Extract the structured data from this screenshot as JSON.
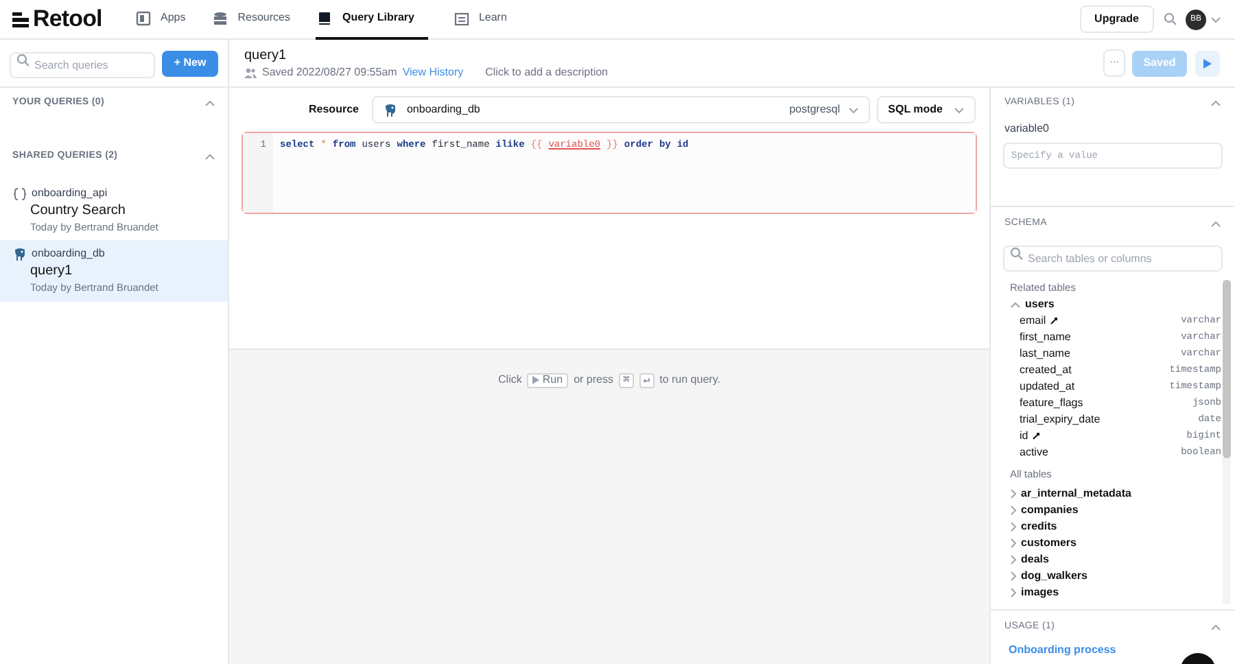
{
  "brand": {
    "name": "Retool"
  },
  "nav": [
    {
      "label": "Apps",
      "selected": false
    },
    {
      "label": "Resources",
      "selected": false
    },
    {
      "label": "Query Library",
      "selected": true
    },
    {
      "label": "Learn",
      "selected": false
    }
  ],
  "topbar": {
    "upgrade": "Upgrade",
    "avatar": "BB"
  },
  "sidebar": {
    "search_placeholder": "Search queries",
    "new_button": "+ New",
    "sections": [
      {
        "title": "YOUR QUERIES (0)",
        "expanded": true
      },
      {
        "title": "SHARED QUERIES (2)",
        "expanded": true,
        "items": [
          {
            "resource": "onboarding_api",
            "kind": "api",
            "name": "Country Search",
            "meta": "Today by Bertrand Bruandet",
            "selected": false
          },
          {
            "resource": "onboarding_db",
            "kind": "postgres",
            "name": "query1",
            "meta": "Today by Bertrand Bruandet",
            "selected": true
          }
        ]
      }
    ]
  },
  "query": {
    "name": "query1",
    "saved": "Saved 2022/08/27 09:55am",
    "history_link": "View History",
    "description_placeholder": "Click to add a description",
    "more_button": "···",
    "save_button": "Saved",
    "save_disabled": true
  },
  "resource": {
    "label": "Resource",
    "name": "onboarding_db",
    "type": "postgresql",
    "mode": "SQL mode"
  },
  "editor": {
    "error": true,
    "lines": [
      {
        "number": "1",
        "tokens": [
          {
            "text": "select",
            "kind": "keyword"
          },
          {
            "text": "*",
            "kind": "operator"
          },
          {
            "text": "from",
            "kind": "keyword"
          },
          {
            "text": "users",
            "kind": "ident"
          },
          {
            "text": "where",
            "kind": "keyword"
          },
          {
            "text": "first_name",
            "kind": "ident"
          },
          {
            "text": "ilike",
            "kind": "keyword"
          },
          {
            "text": "{{",
            "kind": "brace"
          },
          {
            "text": "variable0",
            "kind": "variable"
          },
          {
            "text": "}}",
            "kind": "brace"
          },
          {
            "text": "order",
            "kind": "keyword"
          },
          {
            "text": "by",
            "kind": "keyword"
          },
          {
            "text": "id",
            "kind": "keyword"
          }
        ]
      }
    ]
  },
  "results_hint": {
    "before": "Click",
    "run_key": "Run",
    "middle": "or press",
    "cmd_key": "⌘",
    "enter_key": "↵",
    "after": "to run query."
  },
  "variables": {
    "title": "VARIABLES (1)",
    "expanded": true,
    "items": [
      {
        "name": "variable0",
        "placeholder": "Specify a value"
      }
    ]
  },
  "schema": {
    "title": "SCHEMA",
    "expanded": true,
    "search_placeholder": "Search tables or columns",
    "related_label": "Related tables",
    "related": [
      {
        "name": "users",
        "expanded": true,
        "columns": [
          {
            "name": "email",
            "type": "varchar",
            "indexed": true
          },
          {
            "name": "first_name",
            "type": "varchar",
            "indexed": false
          },
          {
            "name": "last_name",
            "type": "varchar",
            "indexed": false
          },
          {
            "name": "created_at",
            "type": "timestamp",
            "indexed": false
          },
          {
            "name": "updated_at",
            "type": "timestamp",
            "indexed": false
          },
          {
            "name": "feature_flags",
            "type": "jsonb",
            "indexed": false
          },
          {
            "name": "trial_expiry_date",
            "type": "date",
            "indexed": false
          },
          {
            "name": "id",
            "type": "bigint",
            "indexed": true
          },
          {
            "name": "active",
            "type": "boolean",
            "indexed": false
          }
        ]
      }
    ],
    "all_label": "All tables",
    "all": [
      {
        "name": "ar_internal_metadata",
        "expanded": false
      },
      {
        "name": "companies",
        "expanded": false
      },
      {
        "name": "credits",
        "expanded": false
      },
      {
        "name": "customers",
        "expanded": false
      },
      {
        "name": "deals",
        "expanded": false
      },
      {
        "name": "dog_walkers",
        "expanded": false
      },
      {
        "name": "images",
        "expanded": false
      }
    ]
  },
  "usage": {
    "title": "USAGE (1)",
    "expanded": true,
    "items": [
      "Onboarding process"
    ]
  }
}
